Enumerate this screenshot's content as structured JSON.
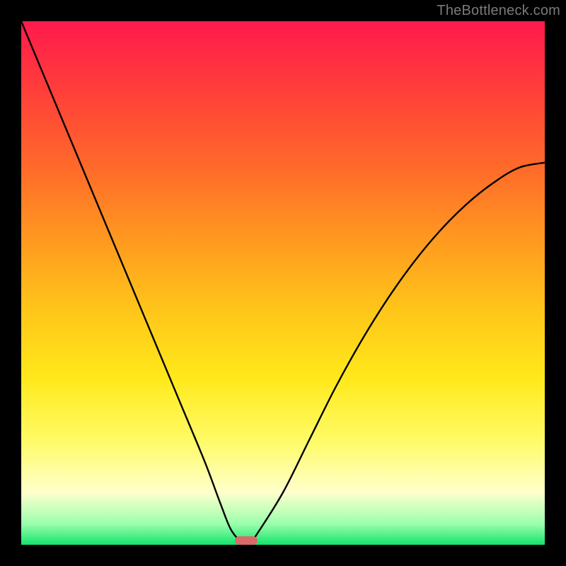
{
  "watermark": "TheBottleneck.com",
  "colors": {
    "background": "#000000",
    "curve": "#000000",
    "marker": "#d96a6a"
  },
  "chart_data": {
    "type": "line",
    "title": "",
    "xlabel": "",
    "ylabel": "",
    "xlim": [
      0,
      100
    ],
    "ylim": [
      0,
      100
    ],
    "gradient_meaning": "bottleneck severity (top=red=worst, bottom=green=best)",
    "series": [
      {
        "name": "bottleneck-curve",
        "x": [
          0,
          5,
          10,
          15,
          20,
          25,
          30,
          35,
          38,
          40,
          42,
          43,
          44,
          45,
          50,
          55,
          60,
          65,
          70,
          75,
          80,
          85,
          90,
          95,
          100
        ],
        "y": [
          100,
          88,
          76,
          64,
          52,
          40,
          28,
          16,
          8,
          3,
          0.5,
          0,
          0.8,
          2,
          10,
          20,
          30,
          39,
          47,
          54,
          60,
          65,
          69,
          72,
          73
        ]
      }
    ],
    "marker": {
      "x": 43,
      "y": 0
    }
  }
}
